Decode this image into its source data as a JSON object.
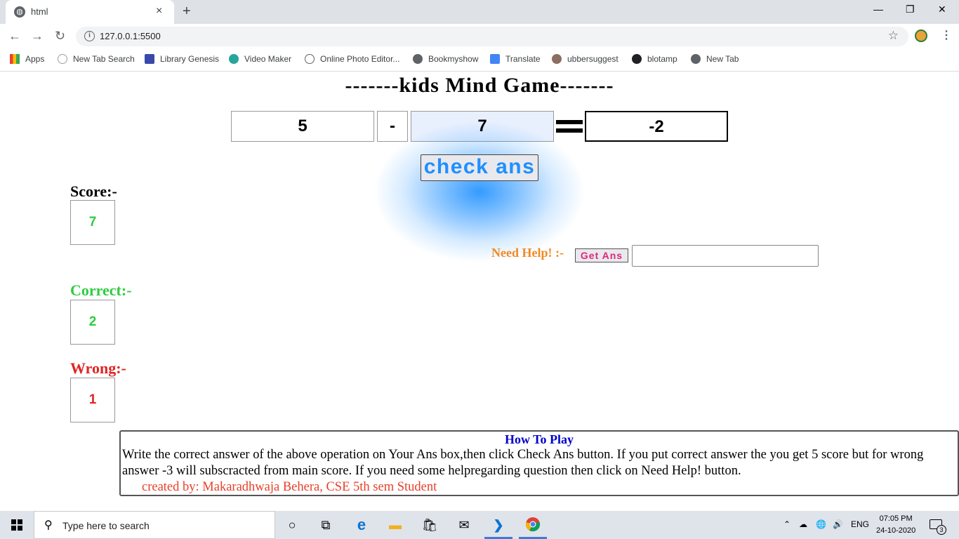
{
  "browser": {
    "tab_title": "html",
    "tab_close": "×",
    "new_tab": "+",
    "url": "127.0.0.1:5500",
    "window_minimize": "—",
    "window_restore": "❐",
    "window_close": "✕",
    "bookmarks": [
      {
        "label": "Apps",
        "color": "#e94235"
      },
      {
        "label": "New Tab Search",
        "color": "#9aa0a6"
      },
      {
        "label": "Library Genesis",
        "color": "#3949ab"
      },
      {
        "label": "Video Maker",
        "color": "#26a69a"
      },
      {
        "label": "Online Photo Editor...",
        "color": "#5f6368"
      },
      {
        "label": "Bookmyshow",
        "color": "#5f6368"
      },
      {
        "label": "Translate",
        "color": "#4285f4"
      },
      {
        "label": "ubbersuggest",
        "color": "#8d6e63"
      },
      {
        "label": "blotamp",
        "color": "#202124"
      },
      {
        "label": "New Tab",
        "color": "#5f6368"
      }
    ]
  },
  "game": {
    "title": "-------kids Mind Game-------",
    "operand1": "5",
    "operator": "-",
    "operand2": "7",
    "answer": "-2",
    "check_button": "check ans",
    "score_label": "Score:-",
    "score_value": "7",
    "correct_label": "Correct:-",
    "correct_value": "2",
    "wrong_label": "Wrong:-",
    "wrong_value": "1",
    "help_label": "Need Help! :-",
    "get_ans_button": "Get Ans",
    "help_answer": ""
  },
  "how_to_play": {
    "title": "How To Play",
    "text": "Write the correct answer of the above operation on Your Ans box,then click Check Ans button. If you put correct answer the you get 5 score but for wrong answer -3 will subscracted from main score. If you need some helpregarding question then click on Need Help! button.",
    "credit": "created by: Makaradhwaja Behera, CSE 5th sem Student"
  },
  "taskbar": {
    "search_placeholder": "Type here to search",
    "language": "ENG",
    "time": "07:05 PM",
    "date": "24-10-2020",
    "notification_count": "3"
  },
  "colors": {
    "accent_blue": "#1e90ff",
    "correct_green": "#2ecc40",
    "wrong_red": "#e02424",
    "help_orange": "#f08a24",
    "get_ans_pink": "#e0267a",
    "howto_blue": "#0000cd",
    "credit_red": "#e8402a"
  }
}
